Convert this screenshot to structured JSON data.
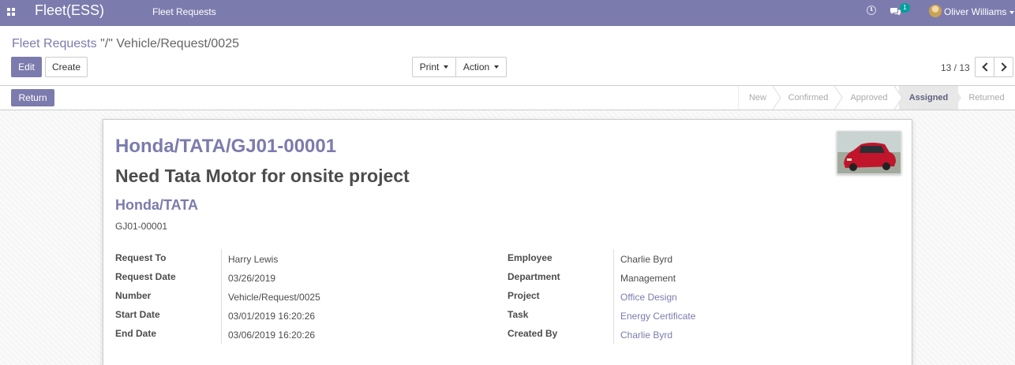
{
  "navbar": {
    "brand": "Fleet(ESS)",
    "menu_item": "Fleet Requests",
    "chat_badge": "1",
    "user_name": "Oliver Williams",
    "color": "#7c7bad"
  },
  "breadcrumb": {
    "parent": "Fleet Requests",
    "current": "\"/\" Vehicle/Request/0025"
  },
  "buttons": {
    "edit": "Edit",
    "create": "Create",
    "print": "Print",
    "action": "Action",
    "return": "Return"
  },
  "pager": {
    "value": "13 / 13"
  },
  "stages": [
    "New",
    "Confirmed",
    "Approved",
    "Assigned",
    "Returned"
  ],
  "current_stage": "Assigned",
  "record": {
    "title": "Honda/TATA/GJ01-00001",
    "subtitle": "Need Tata Motor for onsite project",
    "vehicle_name": "Honda/TATA",
    "license_plate": "GJ01-00001",
    "left_fields": [
      {
        "label": "Request To",
        "value": "Harry Lewis"
      },
      {
        "label": "Request Date",
        "value": "03/26/2019"
      },
      {
        "label": "Number",
        "value": "Vehicle/Request/0025"
      },
      {
        "label": "Start Date",
        "value": "03/01/2019 16:20:26"
      },
      {
        "label": "End Date",
        "value": "03/06/2019 16:20:26"
      }
    ],
    "right_fields": [
      {
        "label": "Employee",
        "value": "Charlie Byrd"
      },
      {
        "label": "Department",
        "value": "Management"
      },
      {
        "label": "Project",
        "value": "Office Design"
      },
      {
        "label": "Task",
        "value": "Energy Certificate"
      },
      {
        "label": "Created By",
        "value": "Charlie Byrd"
      }
    ]
  }
}
